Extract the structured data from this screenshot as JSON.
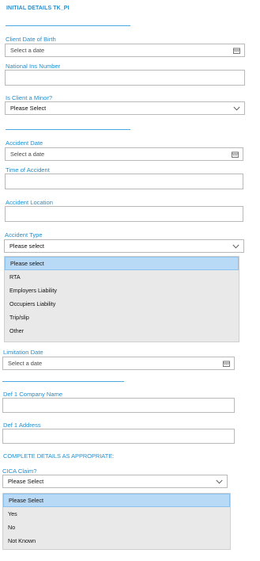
{
  "form": {
    "title": "INITIAL DETAILS TK_PI",
    "client_dob": {
      "label": "Client Date of Birth",
      "placeholder": "Select a date"
    },
    "national_ins": {
      "label": "National Ins Number",
      "value": ""
    },
    "is_minor": {
      "label": "Is Client a Minor?",
      "value": "Please Select"
    },
    "accident_date": {
      "label": "Accident Date",
      "placeholder": "Select a date"
    },
    "time_of_accident": {
      "label": "Time of Accident",
      "value": ""
    },
    "accident_location": {
      "label": "Accident Location",
      "value": ""
    },
    "accident_type": {
      "label": "Accident Type",
      "value": "Please select",
      "options": [
        "Please select",
        "RTA",
        "Employers Liability",
        "Occupiers Liability",
        "Trip/slip",
        "Other"
      ]
    },
    "limitation_date": {
      "label": "Limitation Date",
      "placeholder": "Select a date"
    },
    "def1_company": {
      "label": "Def 1 Company Name",
      "value": ""
    },
    "def1_address": {
      "label": "Def 1 Address",
      "value": ""
    },
    "complete_details": "COMPLETE DETAILS AS APPROPRIATE:",
    "cica_claim": {
      "label": "CICA Claim?",
      "value": "Please Select",
      "options": [
        "Please Select",
        "Yes",
        "No",
        "Not Known"
      ]
    }
  },
  "icons": {
    "calendar": "calendar-icon",
    "chevron": "chevron-down-icon"
  },
  "colors": {
    "accent": "#1f8fd0",
    "selected_option": "#b8daf7",
    "dropdown_bg": "#e9e9e9"
  }
}
